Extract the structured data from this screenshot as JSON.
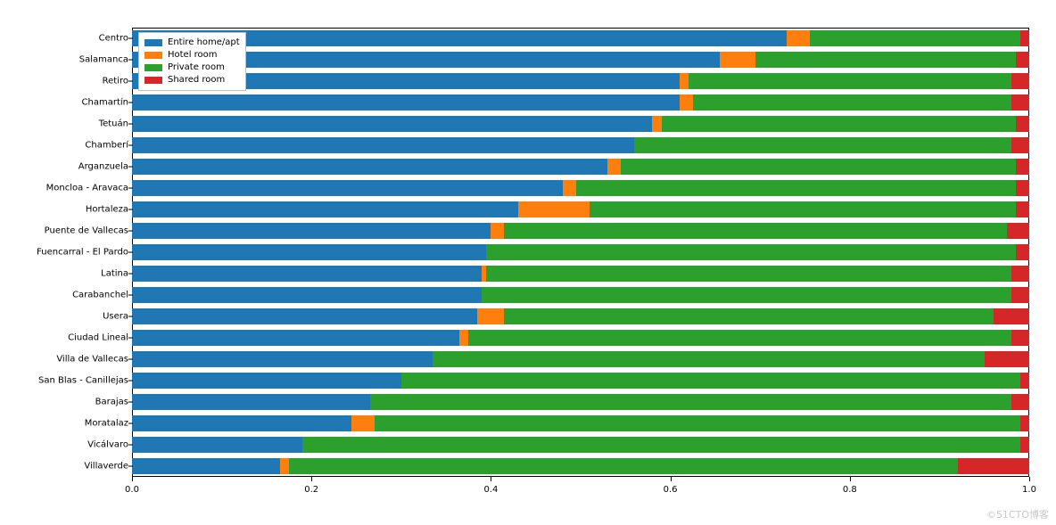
{
  "chart_data": {
    "type": "bar",
    "orientation": "horizontal",
    "stacked": true,
    "xlim": [
      0,
      1.0
    ],
    "x_ticks": [
      0.0,
      0.2,
      0.4,
      0.6,
      0.8,
      1.0
    ],
    "x_tick_labels": [
      "0.0",
      "0.2",
      "0.4",
      "0.6",
      "0.8",
      "1.0"
    ],
    "legend_position": "upper-left",
    "categories": [
      "Centro",
      "Salamanca",
      "Retiro",
      "Chamartín",
      "Tetuán",
      "Chamberí",
      "Arganzuela",
      "Moncloa - Aravaca",
      "Hortaleza",
      "Puente de Vallecas",
      "Fuencarral - El Pardo",
      "Latina",
      "Carabanchel",
      "Usera",
      "Ciudad Lineal",
      "Villa de Vallecas",
      "San Blas - Canillejas",
      "Barajas",
      "Moratalaz",
      "Vicálvaro",
      "Villaverde"
    ],
    "series": [
      {
        "name": "Entire home/apt",
        "color": "#1f77b4",
        "values": [
          0.73,
          0.655,
          0.61,
          0.61,
          0.58,
          0.56,
          0.53,
          0.48,
          0.43,
          0.4,
          0.395,
          0.39,
          0.39,
          0.385,
          0.365,
          0.335,
          0.3,
          0.265,
          0.245,
          0.19,
          0.165
        ]
      },
      {
        "name": "Hotel room",
        "color": "#ff7f0e",
        "values": [
          0.025,
          0.04,
          0.01,
          0.015,
          0.01,
          0.0,
          0.015,
          0.015,
          0.08,
          0.015,
          0.0,
          0.005,
          0.0,
          0.03,
          0.01,
          0.0,
          0.0,
          0.0,
          0.025,
          0.0,
          0.01
        ]
      },
      {
        "name": "Private room",
        "color": "#2ca02c",
        "values": [
          0.235,
          0.29,
          0.36,
          0.355,
          0.395,
          0.42,
          0.44,
          0.49,
          0.475,
          0.56,
          0.59,
          0.585,
          0.59,
          0.545,
          0.605,
          0.615,
          0.69,
          0.715,
          0.72,
          0.8,
          0.745
        ]
      },
      {
        "name": "Shared room",
        "color": "#d62728",
        "values": [
          0.01,
          0.015,
          0.02,
          0.02,
          0.015,
          0.02,
          0.015,
          0.015,
          0.015,
          0.025,
          0.015,
          0.02,
          0.02,
          0.04,
          0.02,
          0.05,
          0.01,
          0.02,
          0.01,
          0.01,
          0.08
        ]
      }
    ]
  },
  "watermark": "©51CTO博客"
}
